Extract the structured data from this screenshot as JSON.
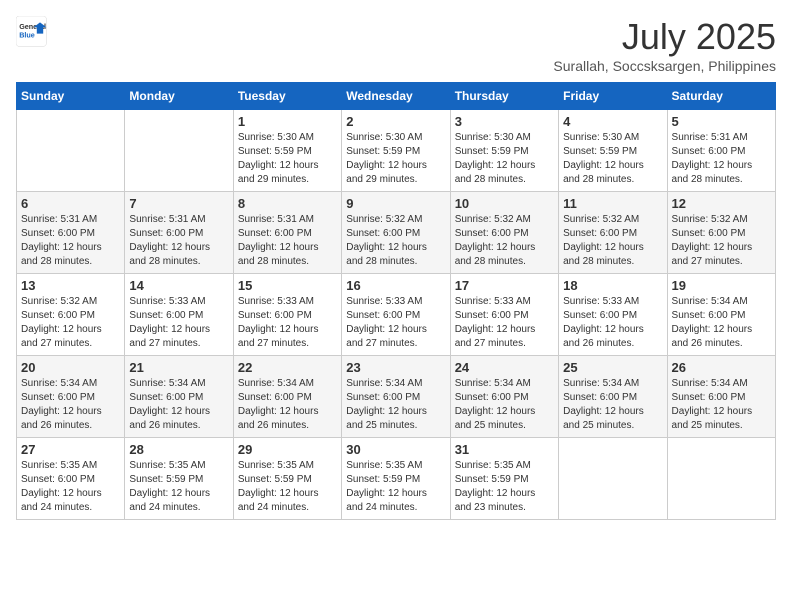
{
  "logo": {
    "general": "General",
    "blue": "Blue"
  },
  "header": {
    "month": "July 2025",
    "location": "Surallah, Soccsksargen, Philippines"
  },
  "weekdays": [
    "Sunday",
    "Monday",
    "Tuesday",
    "Wednesday",
    "Thursday",
    "Friday",
    "Saturday"
  ],
  "weeks": [
    [
      {
        "day": null,
        "info": null
      },
      {
        "day": null,
        "info": null
      },
      {
        "day": "1",
        "info": "Sunrise: 5:30 AM\nSunset: 5:59 PM\nDaylight: 12 hours and 29 minutes."
      },
      {
        "day": "2",
        "info": "Sunrise: 5:30 AM\nSunset: 5:59 PM\nDaylight: 12 hours and 29 minutes."
      },
      {
        "day": "3",
        "info": "Sunrise: 5:30 AM\nSunset: 5:59 PM\nDaylight: 12 hours and 28 minutes."
      },
      {
        "day": "4",
        "info": "Sunrise: 5:30 AM\nSunset: 5:59 PM\nDaylight: 12 hours and 28 minutes."
      },
      {
        "day": "5",
        "info": "Sunrise: 5:31 AM\nSunset: 6:00 PM\nDaylight: 12 hours and 28 minutes."
      }
    ],
    [
      {
        "day": "6",
        "info": "Sunrise: 5:31 AM\nSunset: 6:00 PM\nDaylight: 12 hours and 28 minutes."
      },
      {
        "day": "7",
        "info": "Sunrise: 5:31 AM\nSunset: 6:00 PM\nDaylight: 12 hours and 28 minutes."
      },
      {
        "day": "8",
        "info": "Sunrise: 5:31 AM\nSunset: 6:00 PM\nDaylight: 12 hours and 28 minutes."
      },
      {
        "day": "9",
        "info": "Sunrise: 5:32 AM\nSunset: 6:00 PM\nDaylight: 12 hours and 28 minutes."
      },
      {
        "day": "10",
        "info": "Sunrise: 5:32 AM\nSunset: 6:00 PM\nDaylight: 12 hours and 28 minutes."
      },
      {
        "day": "11",
        "info": "Sunrise: 5:32 AM\nSunset: 6:00 PM\nDaylight: 12 hours and 28 minutes."
      },
      {
        "day": "12",
        "info": "Sunrise: 5:32 AM\nSunset: 6:00 PM\nDaylight: 12 hours and 27 minutes."
      }
    ],
    [
      {
        "day": "13",
        "info": "Sunrise: 5:32 AM\nSunset: 6:00 PM\nDaylight: 12 hours and 27 minutes."
      },
      {
        "day": "14",
        "info": "Sunrise: 5:33 AM\nSunset: 6:00 PM\nDaylight: 12 hours and 27 minutes."
      },
      {
        "day": "15",
        "info": "Sunrise: 5:33 AM\nSunset: 6:00 PM\nDaylight: 12 hours and 27 minutes."
      },
      {
        "day": "16",
        "info": "Sunrise: 5:33 AM\nSunset: 6:00 PM\nDaylight: 12 hours and 27 minutes."
      },
      {
        "day": "17",
        "info": "Sunrise: 5:33 AM\nSunset: 6:00 PM\nDaylight: 12 hours and 27 minutes."
      },
      {
        "day": "18",
        "info": "Sunrise: 5:33 AM\nSunset: 6:00 PM\nDaylight: 12 hours and 26 minutes."
      },
      {
        "day": "19",
        "info": "Sunrise: 5:34 AM\nSunset: 6:00 PM\nDaylight: 12 hours and 26 minutes."
      }
    ],
    [
      {
        "day": "20",
        "info": "Sunrise: 5:34 AM\nSunset: 6:00 PM\nDaylight: 12 hours and 26 minutes."
      },
      {
        "day": "21",
        "info": "Sunrise: 5:34 AM\nSunset: 6:00 PM\nDaylight: 12 hours and 26 minutes."
      },
      {
        "day": "22",
        "info": "Sunrise: 5:34 AM\nSunset: 6:00 PM\nDaylight: 12 hours and 26 minutes."
      },
      {
        "day": "23",
        "info": "Sunrise: 5:34 AM\nSunset: 6:00 PM\nDaylight: 12 hours and 25 minutes."
      },
      {
        "day": "24",
        "info": "Sunrise: 5:34 AM\nSunset: 6:00 PM\nDaylight: 12 hours and 25 minutes."
      },
      {
        "day": "25",
        "info": "Sunrise: 5:34 AM\nSunset: 6:00 PM\nDaylight: 12 hours and 25 minutes."
      },
      {
        "day": "26",
        "info": "Sunrise: 5:34 AM\nSunset: 6:00 PM\nDaylight: 12 hours and 25 minutes."
      }
    ],
    [
      {
        "day": "27",
        "info": "Sunrise: 5:35 AM\nSunset: 6:00 PM\nDaylight: 12 hours and 24 minutes."
      },
      {
        "day": "28",
        "info": "Sunrise: 5:35 AM\nSunset: 5:59 PM\nDaylight: 12 hours and 24 minutes."
      },
      {
        "day": "29",
        "info": "Sunrise: 5:35 AM\nSunset: 5:59 PM\nDaylight: 12 hours and 24 minutes."
      },
      {
        "day": "30",
        "info": "Sunrise: 5:35 AM\nSunset: 5:59 PM\nDaylight: 12 hours and 24 minutes."
      },
      {
        "day": "31",
        "info": "Sunrise: 5:35 AM\nSunset: 5:59 PM\nDaylight: 12 hours and 23 minutes."
      },
      {
        "day": null,
        "info": null
      },
      {
        "day": null,
        "info": null
      }
    ]
  ]
}
